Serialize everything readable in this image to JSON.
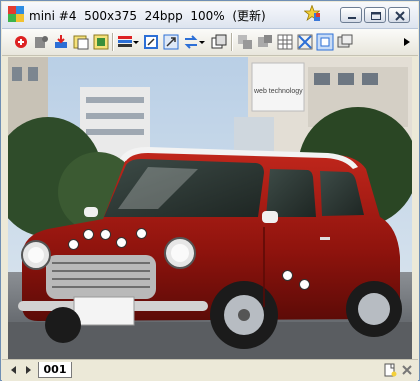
{
  "window": {
    "title": "mini #4  500x375  24bpp  100%  (更新)"
  },
  "titlebar_icons": {
    "app": "image-viewer-icon",
    "star": "star-palette-icon",
    "minimize": "minimize-icon",
    "maximize": "maximize-icon",
    "close": "close-icon"
  },
  "toolbar": {
    "buttons": [
      "open-icon",
      "plugin-icon",
      "import-icon",
      "acquire-icon",
      "filter-icon",
      "color-bars-icon",
      "rotate-icon",
      "fit-window-icon",
      "resize-icon",
      "dropdown-icon",
      "copy-frames-icon",
      "layer-icon",
      "layer2-icon",
      "grid-icon",
      "crop-icon",
      "select-rect-icon",
      "fullscreen-icon",
      "overflow-arrow-icon"
    ]
  },
  "status": {
    "page_label": "001"
  },
  "canvas": {
    "subject": "red mini car on street with buildings",
    "building_sign": "web technology"
  },
  "markers": {
    "count": 7
  }
}
